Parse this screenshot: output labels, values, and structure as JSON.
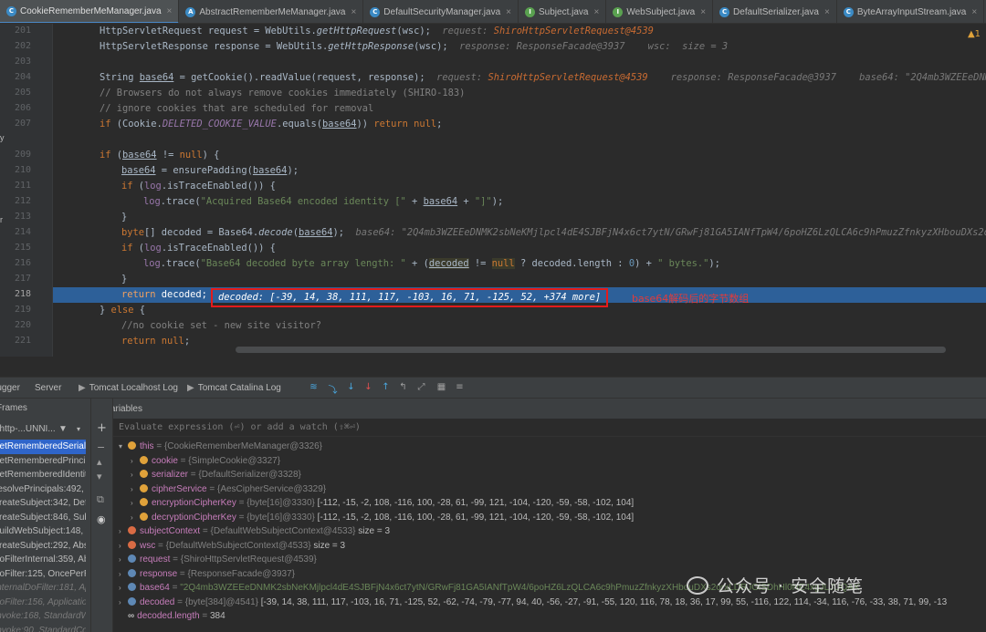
{
  "tabs": [
    {
      "label": "CookieRememberMeManager.java",
      "icon": "C",
      "active": true
    },
    {
      "label": "AbstractRememberMeManager.java",
      "icon": "A"
    },
    {
      "label": "DefaultSecurityManager.java",
      "icon": "C"
    },
    {
      "label": "Subject.java",
      "icon": "I"
    },
    {
      "label": "WebSubject.java",
      "icon": "I"
    },
    {
      "label": "DefaultSerializer.java",
      "icon": "C"
    },
    {
      "label": "ByteArrayInputStream.java",
      "icon": "C"
    }
  ],
  "left_strip": [
    "y",
    "r"
  ],
  "line_numbers": [
    "201",
    "202",
    "203",
    "204",
    "205",
    "206",
    "207",
    "209",
    "210",
    "211",
    "212",
    "213",
    "214",
    "215",
    "216",
    "217",
    "218",
    "219",
    "220",
    "221"
  ],
  "code": {
    "l201": {
      "text": "HttpServletRequest request = WebUtils.",
      "method": "getHttpRequest",
      "rest": "(wsc);",
      "dbg_label": "request: ",
      "dbg_val": "ShiroHttpServletRequest@4539"
    },
    "l202": {
      "text": "HttpServletResponse response = WebUtils.",
      "method": "getHttpResponse",
      "rest": "(wsc);",
      "dbg": "response: ResponseFacade@3937    wsc:  size = 3"
    },
    "l204": {
      "a": "String ",
      "var": "base64",
      "b": " = getCookie().readValue(request, response);",
      "dbg_label": "request: ",
      "dbg_val": "ShiroHttpServletRequest@4539",
      "dbg_rest": "    response: ResponseFacade@3937    base64: \"2Q4mb3WZEEeDNMK2sbN"
    },
    "l205": "// Browsers do not always remove cookies immediately (SHIRO-183)",
    "l206": "// ignore cookies that are scheduled for removal",
    "l207": {
      "kw": "if",
      "a": " (Cookie.",
      "fld": "DELETED_COOKIE_VALUE",
      "b": ".equals(",
      "var": "base64",
      "c": ")) ",
      "kw2": "return null",
      "d": ";"
    },
    "l209": {
      "kw": "if",
      "a": " (",
      "var": "base64",
      "b": " != ",
      "kw2": "null",
      "c": ") {"
    },
    "l210": {
      "var": "base64",
      "a": " = ensurePadding(",
      "var2": "base64",
      "b": ");"
    },
    "l211": {
      "kw": "if",
      "a": " (",
      "log": "log",
      "b": ".isTraceEnabled()) {"
    },
    "l212": {
      "log": "log",
      "a": ".trace(",
      "str": "\"Acquired Base64 encoded identity [\"",
      "b": " + ",
      "var": "base64",
      "c": " + ",
      "str2": "\"]\"",
      "d": ");"
    },
    "l213": "}",
    "l214": {
      "kw": "byte",
      "a": "[] decoded = Base64.",
      "method": "decode",
      "b": "(",
      "var": "base64",
      "c": ");",
      "dbg": "base64: \"2Q4mb3WZEEeDNMK2sbNeKMjlpcl4dE4SJBFjN4x6ct7ytN/GRwFj81GA5IANfTpW4/6poHZ6LzQLCA6c9hPmuzZfnkyzXHbouDXs2orxLDR"
    },
    "l215": {
      "kw": "if",
      "a": " (",
      "log": "log",
      "b": ".isTraceEnabled()) {"
    },
    "l216": {
      "log": "log",
      "a": ".trace(",
      "str": "\"Base64 decoded byte array length: \"",
      "b": " + (",
      "var": "decoded",
      "c": " != ",
      "kw": "null",
      "d": " ? decoded.length : ",
      "num": "0",
      "e": ") + ",
      "str2": "\" bytes.\"",
      "f": ");"
    },
    "l217": "}",
    "l218": {
      "kw": "return",
      "a": " decoded;",
      "box": "decoded: [-39, 14, 38, 111, 117, -103, 16, 71, -125, 52, +374 more]"
    },
    "l219": {
      "a": "} ",
      "kw": "else",
      "b": " {"
    },
    "l220": "//no cookie set - new site visitor?",
    "l221": {
      "kw": "return null",
      "a": ";"
    }
  },
  "annotation": "base64解码后的字节数组",
  "debug_toolbar": {
    "debugger": "Debugger",
    "server": "Server",
    "tomcat_localhost": "Tomcat Localhost Log",
    "tomcat_catalina": "Tomcat Catalina Log"
  },
  "frames_header": {
    "frames": "Frames",
    "thread": "\"http-...UNNI..."
  },
  "frames": [
    "getRememberedSerializedIdentity:",
    "getRememberedPrincipals:",
    "getRememberedIdentity:",
    "resolvePrincipals:492, D",
    "createSubject:342, Defa",
    "createSubject:846, Subje",
    "buildWebSubject:148, W",
    "createSubject:292, Abst",
    "doFilterInternal:359, Abs",
    "doFilter:125, OncePerRe",
    "internalDoFilter:181, App",
    "doFilter:156, Application",
    "invoke:168, StandardWr",
    "invoke:90, StandardCon"
  ],
  "variables_header": "Variables",
  "eval_placeholder": "Evaluate expression (⏎) or add a watch (⇧⌘⏎)",
  "variables": [
    {
      "indent": 0,
      "arrow": "▾",
      "icon": "this",
      "name": "this",
      "type": " = {CookieRememberMeManager@3326}"
    },
    {
      "indent": 1,
      "arrow": "›",
      "icon": "f",
      "name": "cookie",
      "type": " = {SimpleCookie@3327}"
    },
    {
      "indent": 1,
      "arrow": "›",
      "icon": "f",
      "name": "serializer",
      "type": " = {DefaultSerializer@3328}"
    },
    {
      "indent": 1,
      "arrow": "›",
      "icon": "f",
      "name": "cipherService",
      "type": " = {AesCipherService@3329}"
    },
    {
      "indent": 1,
      "arrow": "›",
      "icon": "f",
      "name": "encryptionCipherKey",
      "type": " = {byte[16]@3330} ",
      "value": "[-112, -15, -2, 108, -116, 100, -28, 61, -99, 121, -104, -120, -59, -58, -102, 104]"
    },
    {
      "indent": 1,
      "arrow": "›",
      "icon": "f",
      "name": "decryptionCipherKey",
      "type": " = {byte[16]@3330} ",
      "value": "[-112, -15, -2, 108, -116, 100, -28, 61, -99, 121, -104, -120, -59, -58, -102, 104]"
    },
    {
      "indent": 0,
      "arrow": "›",
      "icon": "p",
      "name": "subjectContext",
      "type": " = {DefaultWebSubjectContext@4533} ",
      "value": " size = 3"
    },
    {
      "indent": 0,
      "arrow": "›",
      "icon": "p",
      "name": "wsc",
      "type": " = {DefaultWebSubjectContext@4533} ",
      "value": " size = 3"
    },
    {
      "indent": 0,
      "arrow": "›",
      "icon": "l",
      "name": "request",
      "type": " = {ShiroHttpServletRequest@4539}"
    },
    {
      "indent": 0,
      "arrow": "›",
      "icon": "l",
      "name": "response",
      "type": " = {ResponseFacade@3937}"
    },
    {
      "indent": 0,
      "arrow": "›",
      "icon": "l",
      "name": "base64",
      "type": " = ",
      "str": "\"2Q4mb3WZEEeDNMK2sbNeKMjlpcl4dE4SJBFjN4x6ct7ytN/GRwFj81GA5IANfTpW4/6poHZ6LzQLCA6c9hPmuzZfnkyzXHbouDXs2orxLDRJGlSDhHl0NE4xgJLJUQAX"
    },
    {
      "indent": 0,
      "arrow": "›",
      "icon": "l",
      "name": "decoded",
      "type": " = {byte[384]@4541} ",
      "value": "[-39, 14, 38, 111, 117, -103, 16, 71, -125, 52, -62, -74, -79, -77, 94, 40, -56, -27, -91, -55, 120, 116, 78, 18, 36, 17, 99, 55, -116, 122, 114, -34, 116, -76, -33, 38, 71, 99, -13"
    },
    {
      "indent": 0,
      "arrow": "",
      "icon": "oo",
      "name": "decoded.length",
      "type": " = ",
      "value": "384"
    }
  ],
  "watermark": "公众号 · 安全随笔"
}
